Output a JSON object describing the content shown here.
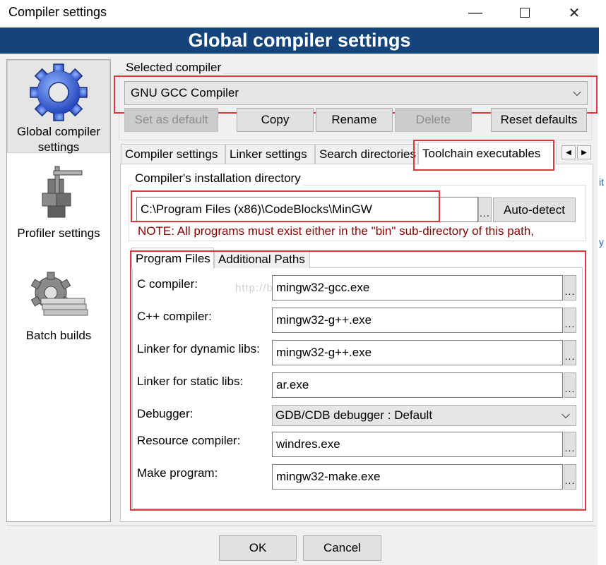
{
  "window": {
    "title": "Compiler settings"
  },
  "header": {
    "title": "Global compiler settings"
  },
  "sidebar": {
    "items": [
      {
        "label": "Global compiler settings",
        "line1": "Global compiler",
        "line2": "settings"
      },
      {
        "label": "Profiler settings"
      },
      {
        "label": "Batch builds"
      }
    ]
  },
  "compiler": {
    "legend": "Selected compiler",
    "selected": "GNU GCC Compiler",
    "buttons": {
      "set_default": "Set as default",
      "copy": "Copy",
      "rename": "Rename",
      "delete": "Delete",
      "reset": "Reset defaults"
    }
  },
  "tabs": [
    "Compiler settings",
    "Linker settings",
    "Search directories",
    "Toolchain executables"
  ],
  "install": {
    "legend": "Compiler's installation directory",
    "path": "C:\\Program Files (x86)\\CodeBlocks\\MinGW",
    "browse": "...",
    "autodetect": "Auto-detect",
    "note": "NOTE: All programs must exist either in the \"bin\" sub-directory of this path,"
  },
  "subtabs": [
    "Program Files",
    "Additional Paths"
  ],
  "programs": [
    {
      "label": "C compiler:",
      "value": "mingw32-gcc.exe"
    },
    {
      "label": "C++ compiler:",
      "value": "mingw32-g++.exe"
    },
    {
      "label": "Linker for dynamic libs:",
      "value": "mingw32-g++.exe"
    },
    {
      "label": "Linker for static libs:",
      "value": "ar.exe"
    },
    {
      "label": "Debugger:",
      "value": "GDB/CDB debugger : Default"
    },
    {
      "label": "Resource compiler:",
      "value": "windres.exe"
    },
    {
      "label": "Make program:",
      "value": "mingw32-make.exe"
    }
  ],
  "browse_label": "...",
  "watermark": "http://blog.csdn.net/",
  "footer": {
    "ok": "OK",
    "cancel": "Cancel"
  },
  "colors": {
    "header": "#15447c",
    "highlight_box": "#e0373c",
    "note_text": "#8b0000"
  }
}
